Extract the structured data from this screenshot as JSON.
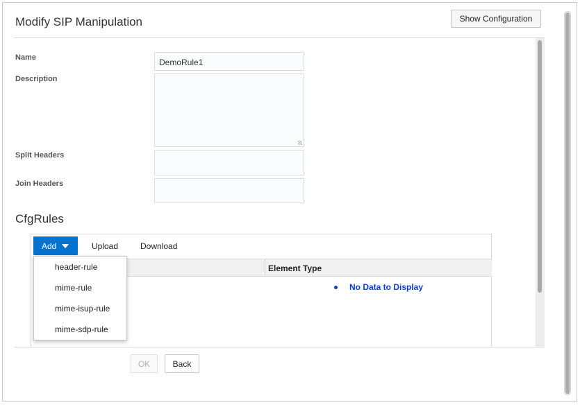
{
  "page": {
    "title": "Modify SIP Manipulation",
    "show_config_label": "Show Configuration"
  },
  "form": {
    "name_label": "Name",
    "name_value": "DemoRule1",
    "description_label": "Description",
    "description_value": "",
    "split_headers_label": "Split Headers",
    "split_headers_value": "",
    "join_headers_label": "Join Headers",
    "join_headers_value": ""
  },
  "cfgrules": {
    "title": "CfgRules",
    "toolbar": {
      "add_label": "Add",
      "upload_label": "Upload",
      "download_label": "Download"
    },
    "columns": [
      "",
      "Element Type"
    ],
    "empty_text": "No Data to Display",
    "add_menu": [
      "header-rule",
      "mime-rule",
      "mime-isup-rule",
      "mime-sdp-rule"
    ]
  },
  "actions": {
    "ok_label": "OK",
    "back_label": "Back"
  },
  "colors": {
    "accent": "#0572ce",
    "nodata": "#0b3bd6"
  }
}
